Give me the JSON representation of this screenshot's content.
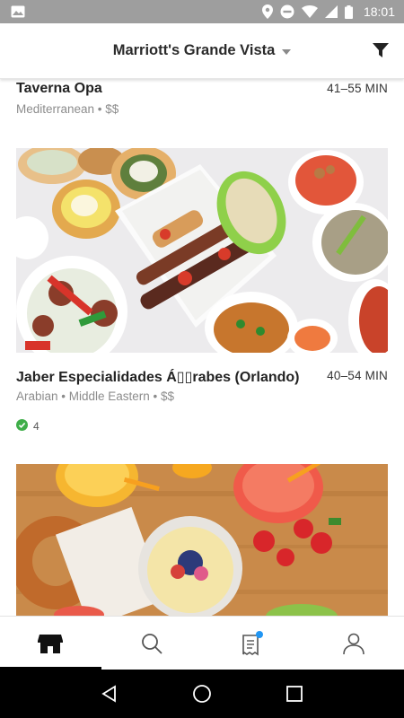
{
  "status_bar": {
    "time": "18:01",
    "icons": [
      "image-icon",
      "location-icon",
      "do-not-disturb-icon",
      "wifi-icon",
      "signal-icon",
      "battery-icon"
    ]
  },
  "header": {
    "location": "Marriott's Grande Vista",
    "filter_icon": "filter-icon"
  },
  "restaurants": [
    {
      "name": "Taverna Opa",
      "eta": "41–55 MIN",
      "tags": "Mediterranean • $$"
    },
    {
      "name": "Jaber Especialidades Á▯▯rabes (Orlando)",
      "eta": "40–54 MIN",
      "tags": "Arabian • Middle Eastern • $$",
      "rating": "4"
    }
  ],
  "bottom_nav": {
    "tabs": [
      "home-icon",
      "search-icon",
      "orders-icon",
      "account-icon"
    ],
    "active": "home-icon",
    "orders_badge_color": "#2196f3"
  },
  "colors": {
    "rating_badge": "#3fae49",
    "status_bar": "#9e9e9e"
  }
}
